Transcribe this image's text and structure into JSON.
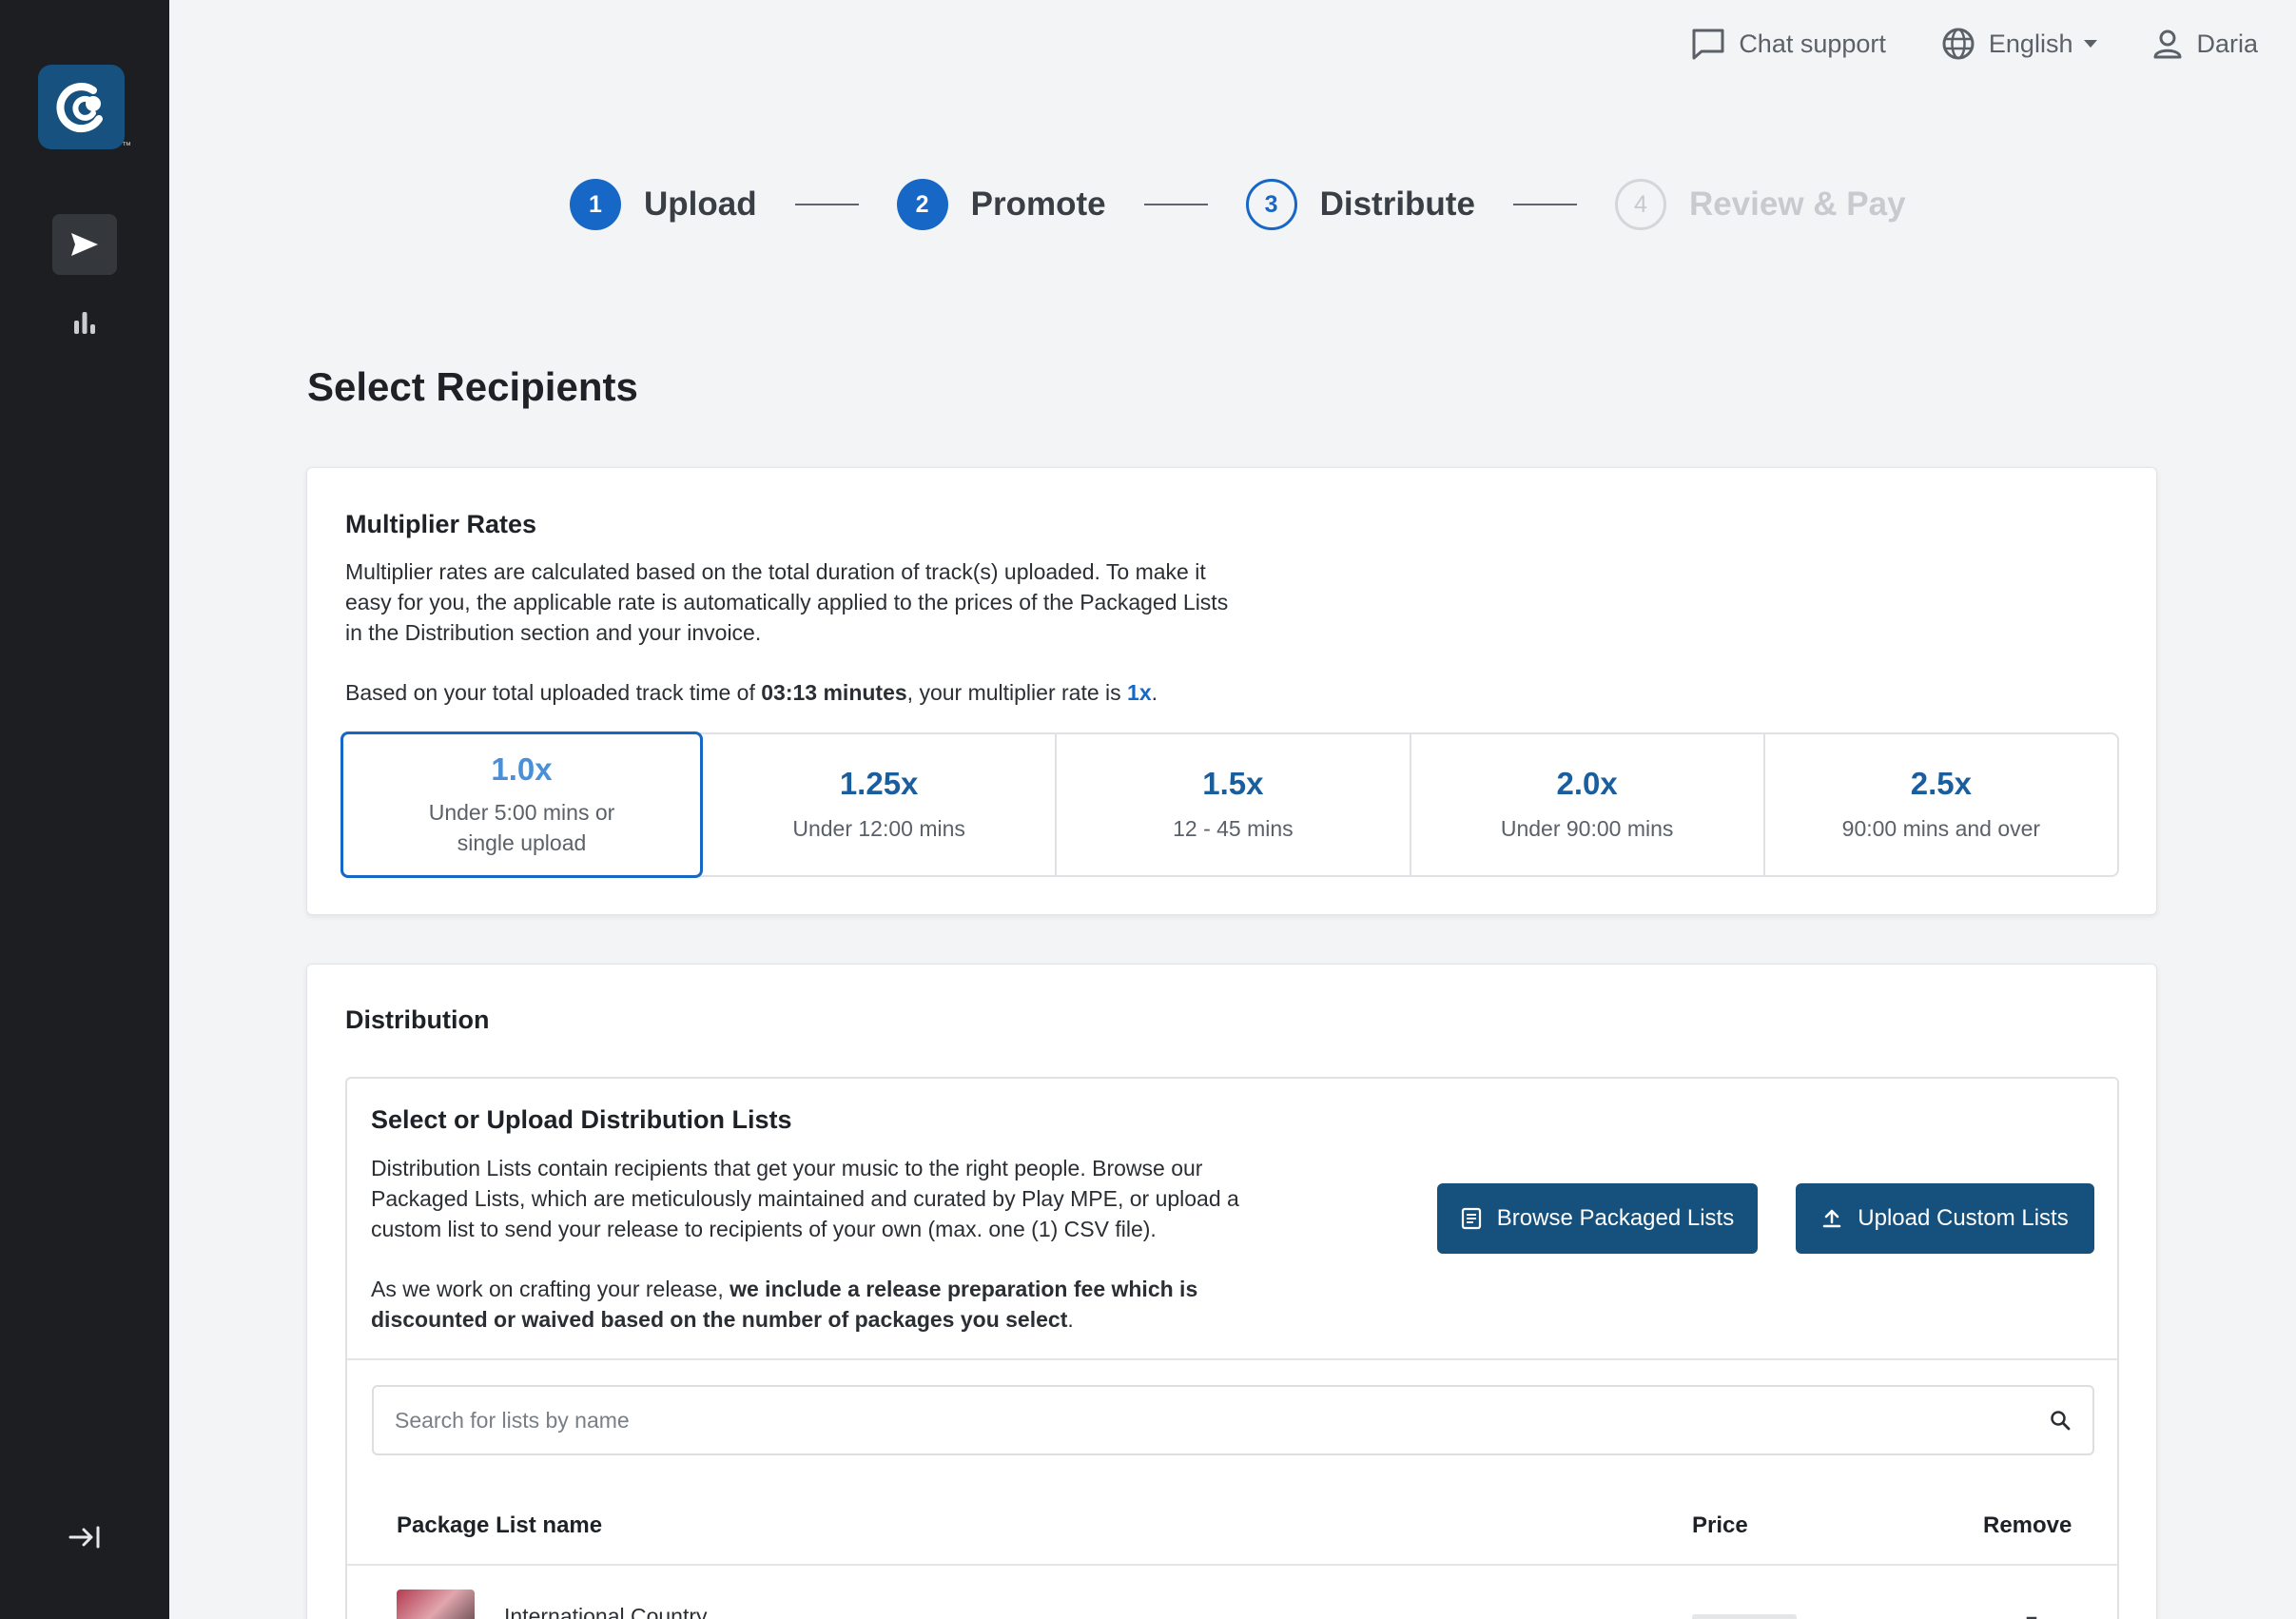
{
  "app": {
    "logo_tm": "™"
  },
  "topbar": {
    "chat_label": "Chat support",
    "language_label": "English",
    "user_label": "Daria"
  },
  "stepper": [
    {
      "number": "1",
      "label": "Upload",
      "state": "done"
    },
    {
      "number": "2",
      "label": "Promote",
      "state": "done"
    },
    {
      "number": "3",
      "label": "Distribute",
      "state": "current"
    },
    {
      "number": "4",
      "label": "Review & Pay",
      "state": "pending"
    }
  ],
  "page_title": "Select Recipients",
  "multiplier": {
    "title": "Multiplier Rates",
    "description": "Multiplier rates are calculated based on the total duration of track(s) uploaded. To make it easy for you, the applicable rate is automatically applied to the prices of the Packaged Lists in the Distribution section and your invoice.",
    "summary_prefix": "Based on your total uploaded track time of ",
    "track_time": "03:13 minutes",
    "summary_middle": ", your multiplier rate is ",
    "rate": "1x",
    "summary_suffix": ".",
    "rates": [
      {
        "value": "1.0x",
        "desc": "Under 5:00 mins or single upload",
        "selected": true
      },
      {
        "value": "1.25x",
        "desc": "Under 12:00 mins",
        "selected": false
      },
      {
        "value": "1.5x",
        "desc": "12 - 45 mins",
        "selected": false
      },
      {
        "value": "2.0x",
        "desc": "Under 90:00 mins",
        "selected": false
      },
      {
        "value": "2.5x",
        "desc": "90:00 mins and over",
        "selected": false
      }
    ]
  },
  "distribution": {
    "title": "Distribution",
    "box_title": "Select or Upload Distribution Lists",
    "description": "Distribution Lists contain recipients that get your music to the right people. Browse our Packaged Lists, which are meticulously maintained and curated by Play MPE, or upload a custom list to send your release to recipients of your own (max. one (1) CSV file).",
    "fee_prefix": "As we work on crafting your release, ",
    "fee_bold": "we include a release preparation fee which is discounted or waived based on the number of packages you select",
    "fee_suffix": ".",
    "browse_label": "Browse Packaged Lists",
    "upload_label": "Upload Custom Lists",
    "search_placeholder": "Search for lists by name",
    "columns": {
      "name": "Package List name",
      "price": "Price",
      "remove": "Remove"
    },
    "rows": [
      {
        "name": "International Country"
      }
    ]
  },
  "colors": {
    "sidebar": "#1c1e21",
    "brand": "#16507d",
    "accent": "#1767c7",
    "background": "#f3f4f6"
  }
}
